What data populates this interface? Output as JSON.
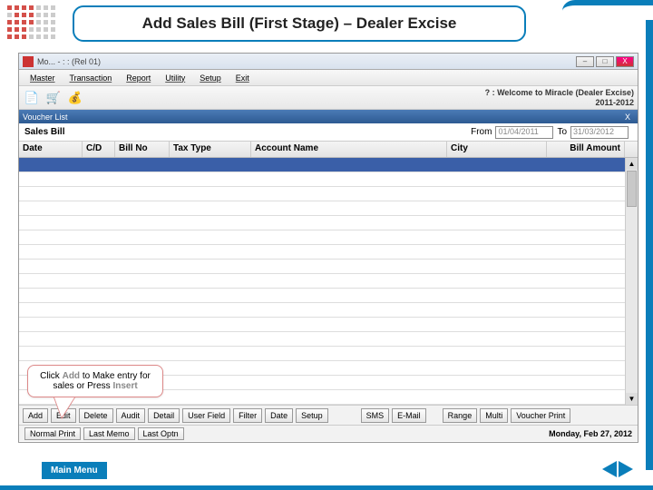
{
  "slide_title": "Add Sales Bill (First Stage) – Dealer Excise",
  "window_title": "Mo... - : : (Rel 01)",
  "menus": {
    "master": "Master",
    "transaction": "Transaction",
    "report": "Report",
    "utility": "Utility",
    "setup": "Setup",
    "exit": "Exit"
  },
  "welcome_line1": "? : Welcome to Miracle (Dealer Excise)",
  "welcome_line2": "2011-2012",
  "voucher_list_title": "Voucher List",
  "filter": {
    "label": "Sales Bill",
    "from": "From",
    "to": "To",
    "from_val": "01/04/2011",
    "to_val": "31/03/2012"
  },
  "cols": {
    "date": "Date",
    "cd": "C/D",
    "billno": "Bill No",
    "tax": "Tax Type",
    "account": "Account Name",
    "city": "City",
    "amount": "Bill Amount"
  },
  "buttons": {
    "add": "Add",
    "edit": "Edit",
    "delete": "Delete",
    "audit": "Audit",
    "detail": "Detail",
    "userfield": "User Field",
    "filter": "Filter",
    "date": "Date",
    "setup": "Setup",
    "sms": "SMS",
    "email": "E-Mail",
    "range": "Range",
    "multi": "Multi",
    "vprint": "Voucher Print"
  },
  "status": {
    "normal": "Normal Print",
    "lastmemo": "Last Memo",
    "lastoptn": "Last Optn",
    "date": "Monday, Feb 27, 2012"
  },
  "callout": {
    "prefix": "Click ",
    "add": "Add",
    "mid": " to Make entry for sales or Press ",
    "insert": "Insert"
  },
  "main_menu": "Main Menu",
  "win_btns": {
    "min": "–",
    "max": "□",
    "close": "X"
  }
}
